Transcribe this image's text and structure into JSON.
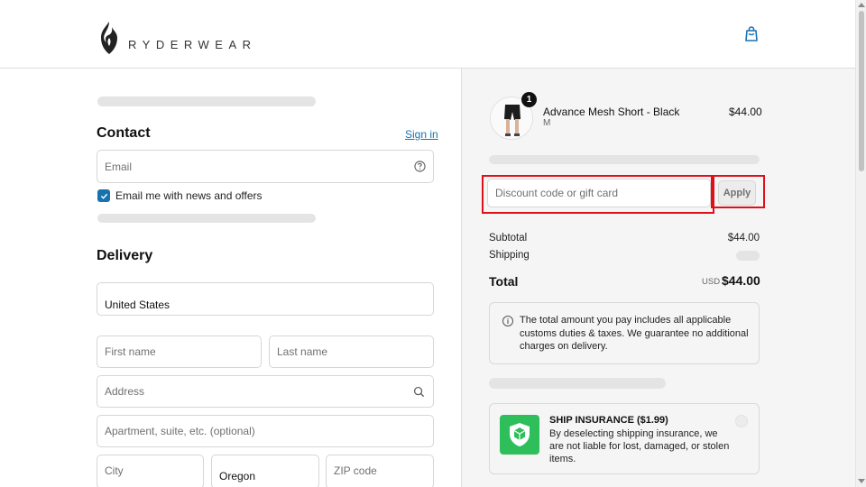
{
  "header": {
    "brand": "RYDERWEAR"
  },
  "contact": {
    "heading": "Contact",
    "sign_in_label": "Sign in",
    "email_placeholder": "Email",
    "newsletter_label": "Email me with news and offers",
    "newsletter_checked": true
  },
  "delivery": {
    "heading": "Delivery",
    "country_value": "United States",
    "first_name_placeholder": "First name",
    "last_name_placeholder": "Last name",
    "address_placeholder": "Address",
    "apartment_placeholder": "Apartment, suite, etc. (optional)",
    "city_placeholder": "City",
    "state_value": "Oregon",
    "zip_placeholder": "ZIP code"
  },
  "order": {
    "product_name": "Advance Mesh Short - Black",
    "product_variant": "M",
    "product_price": "$44.00",
    "quantity": "1",
    "discount_placeholder": "Discount code or gift card",
    "apply_label": "Apply",
    "subtotal_label": "Subtotal",
    "subtotal_value": "$44.00",
    "shipping_label": "Shipping",
    "total_label": "Total",
    "currency": "USD",
    "total_value": "$44.00",
    "duties_note": "The total amount you pay includes all applicable customs duties & taxes. We guarantee no additional charges on delivery.",
    "insurance_title": "SHIP INSURANCE ($1.99)",
    "insurance_text": "By deselecting shipping insurance, we are not liable for lost, damaged, or stolen items."
  },
  "colors": {
    "accent": "#1773b0",
    "highlight": "#e0101a",
    "insurance_green": "#2fbf5a"
  }
}
